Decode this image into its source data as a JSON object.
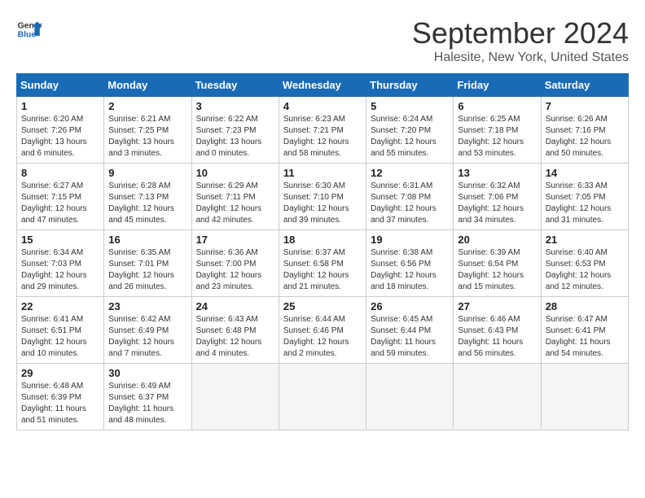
{
  "header": {
    "logo_line1": "General",
    "logo_line2": "Blue",
    "title": "September 2024",
    "subtitle": "Halesite, New York, United States"
  },
  "calendar": {
    "days_of_week": [
      "Sunday",
      "Monday",
      "Tuesday",
      "Wednesday",
      "Thursday",
      "Friday",
      "Saturday"
    ],
    "weeks": [
      [
        {
          "num": "",
          "empty": true
        },
        {
          "num": "",
          "empty": true
        },
        {
          "num": "",
          "empty": true
        },
        {
          "num": "",
          "empty": true
        },
        {
          "num": "",
          "empty": true
        },
        {
          "num": "",
          "empty": true
        },
        {
          "num": "",
          "empty": true
        }
      ],
      [
        {
          "num": "1",
          "sunrise": "6:20 AM",
          "sunset": "7:26 PM",
          "daylight": "13 hours and 6 minutes."
        },
        {
          "num": "2",
          "sunrise": "6:21 AM",
          "sunset": "7:25 PM",
          "daylight": "13 hours and 3 minutes."
        },
        {
          "num": "3",
          "sunrise": "6:22 AM",
          "sunset": "7:23 PM",
          "daylight": "13 hours and 0 minutes."
        },
        {
          "num": "4",
          "sunrise": "6:23 AM",
          "sunset": "7:21 PM",
          "daylight": "12 hours and 58 minutes."
        },
        {
          "num": "5",
          "sunrise": "6:24 AM",
          "sunset": "7:20 PM",
          "daylight": "12 hours and 55 minutes."
        },
        {
          "num": "6",
          "sunrise": "6:25 AM",
          "sunset": "7:18 PM",
          "daylight": "12 hours and 53 minutes."
        },
        {
          "num": "7",
          "sunrise": "6:26 AM",
          "sunset": "7:16 PM",
          "daylight": "12 hours and 50 minutes."
        }
      ],
      [
        {
          "num": "8",
          "sunrise": "6:27 AM",
          "sunset": "7:15 PM",
          "daylight": "12 hours and 47 minutes."
        },
        {
          "num": "9",
          "sunrise": "6:28 AM",
          "sunset": "7:13 PM",
          "daylight": "12 hours and 45 minutes."
        },
        {
          "num": "10",
          "sunrise": "6:29 AM",
          "sunset": "7:11 PM",
          "daylight": "12 hours and 42 minutes."
        },
        {
          "num": "11",
          "sunrise": "6:30 AM",
          "sunset": "7:10 PM",
          "daylight": "12 hours and 39 minutes."
        },
        {
          "num": "12",
          "sunrise": "6:31 AM",
          "sunset": "7:08 PM",
          "daylight": "12 hours and 37 minutes."
        },
        {
          "num": "13",
          "sunrise": "6:32 AM",
          "sunset": "7:06 PM",
          "daylight": "12 hours and 34 minutes."
        },
        {
          "num": "14",
          "sunrise": "6:33 AM",
          "sunset": "7:05 PM",
          "daylight": "12 hours and 31 minutes."
        }
      ],
      [
        {
          "num": "15",
          "sunrise": "6:34 AM",
          "sunset": "7:03 PM",
          "daylight": "12 hours and 29 minutes."
        },
        {
          "num": "16",
          "sunrise": "6:35 AM",
          "sunset": "7:01 PM",
          "daylight": "12 hours and 26 minutes."
        },
        {
          "num": "17",
          "sunrise": "6:36 AM",
          "sunset": "7:00 PM",
          "daylight": "12 hours and 23 minutes."
        },
        {
          "num": "18",
          "sunrise": "6:37 AM",
          "sunset": "6:58 PM",
          "daylight": "12 hours and 21 minutes."
        },
        {
          "num": "19",
          "sunrise": "6:38 AM",
          "sunset": "6:56 PM",
          "daylight": "12 hours and 18 minutes."
        },
        {
          "num": "20",
          "sunrise": "6:39 AM",
          "sunset": "6:54 PM",
          "daylight": "12 hours and 15 minutes."
        },
        {
          "num": "21",
          "sunrise": "6:40 AM",
          "sunset": "6:53 PM",
          "daylight": "12 hours and 12 minutes."
        }
      ],
      [
        {
          "num": "22",
          "sunrise": "6:41 AM",
          "sunset": "6:51 PM",
          "daylight": "12 hours and 10 minutes."
        },
        {
          "num": "23",
          "sunrise": "6:42 AM",
          "sunset": "6:49 PM",
          "daylight": "12 hours and 7 minutes."
        },
        {
          "num": "24",
          "sunrise": "6:43 AM",
          "sunset": "6:48 PM",
          "daylight": "12 hours and 4 minutes."
        },
        {
          "num": "25",
          "sunrise": "6:44 AM",
          "sunset": "6:46 PM",
          "daylight": "12 hours and 2 minutes."
        },
        {
          "num": "26",
          "sunrise": "6:45 AM",
          "sunset": "6:44 PM",
          "daylight": "11 hours and 59 minutes."
        },
        {
          "num": "27",
          "sunrise": "6:46 AM",
          "sunset": "6:43 PM",
          "daylight": "11 hours and 56 minutes."
        },
        {
          "num": "28",
          "sunrise": "6:47 AM",
          "sunset": "6:41 PM",
          "daylight": "11 hours and 54 minutes."
        }
      ],
      [
        {
          "num": "29",
          "sunrise": "6:48 AM",
          "sunset": "6:39 PM",
          "daylight": "11 hours and 51 minutes."
        },
        {
          "num": "30",
          "sunrise": "6:49 AM",
          "sunset": "6:37 PM",
          "daylight": "11 hours and 48 minutes."
        },
        {
          "num": "",
          "empty": true
        },
        {
          "num": "",
          "empty": true
        },
        {
          "num": "",
          "empty": true
        },
        {
          "num": "",
          "empty": true
        },
        {
          "num": "",
          "empty": true
        }
      ]
    ]
  }
}
